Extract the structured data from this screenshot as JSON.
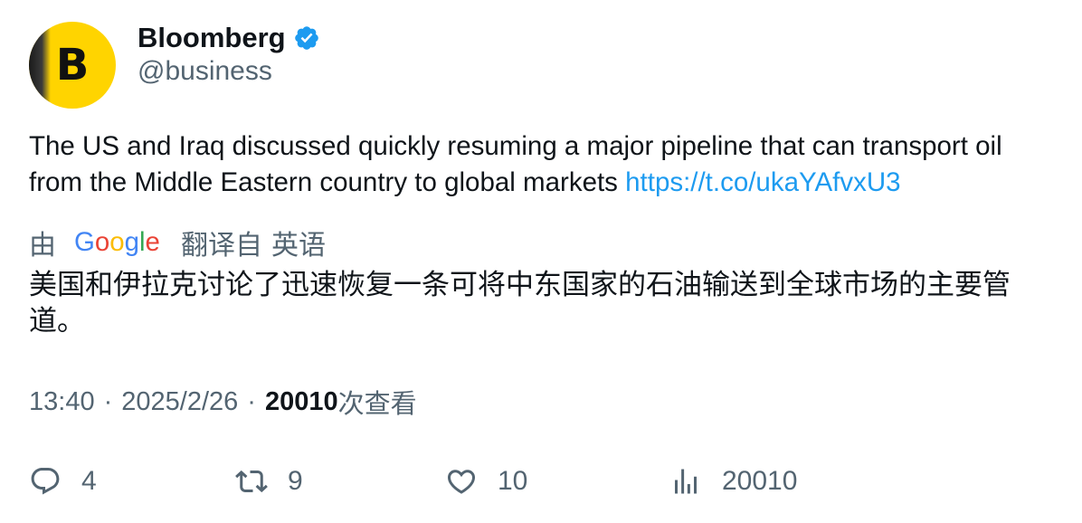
{
  "author": {
    "name": "Bloomberg",
    "handle": "@business",
    "avatar_letter": "B",
    "avatar_color": "#ffd400",
    "verified": true,
    "verified_color": "#1d9bf0"
  },
  "tweet": {
    "text": "The US and Iraq discussed quickly resuming a major pipeline that can transport oil from the Middle Eastern country to global markets ",
    "link": "https://t.co/ukaYAfvxU3",
    "link_color": "#1d9bf0"
  },
  "translation": {
    "prefix": "由",
    "provider": "Google",
    "suffix": "翻译自",
    "source_language": "英语",
    "translated_text": "美国和伊拉克讨论了迅速恢复一条可将中东国家的石油输送到全球市场的主要管道。"
  },
  "meta": {
    "time": "13:40",
    "separator": "·",
    "date": "2025/2/26",
    "views_count": "20010",
    "views_label": "次查看"
  },
  "actions": {
    "replies": "4",
    "reposts": "9",
    "likes": "10",
    "views": "20010"
  }
}
